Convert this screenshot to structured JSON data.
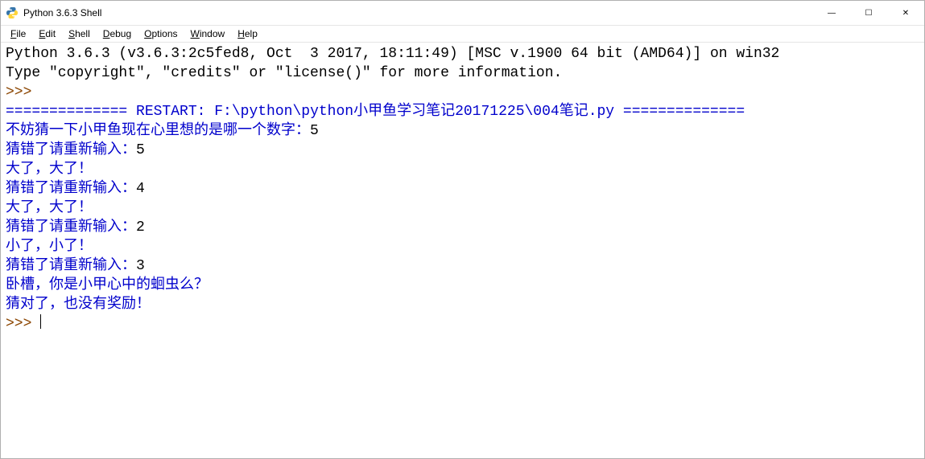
{
  "window": {
    "title": "Python 3.6.3 Shell",
    "controls": {
      "min": "—",
      "max": "☐",
      "close": "✕"
    }
  },
  "menu": {
    "file": {
      "u": "F",
      "rest": "ile"
    },
    "edit": {
      "u": "E",
      "rest": "dit"
    },
    "shell": {
      "u": "S",
      "rest": "hell"
    },
    "debug": {
      "u": "D",
      "rest": "ebug"
    },
    "options": {
      "u": "O",
      "rest": "ptions"
    },
    "window": {
      "u": "W",
      "rest": "indow"
    },
    "help": {
      "u": "H",
      "rest": "elp"
    }
  },
  "console": {
    "banner1": "Python 3.6.3 (v3.6.3:2c5fed8, Oct  3 2017, 18:11:49) [MSC v.1900 64 bit (AMD64)] on win32",
    "banner2": "Type \"copyright\", \"credits\" or \"license()\" for more information.",
    "prompt": ">>> ",
    "restart_pre": "============== RESTART: ",
    "restart_path": "F:\\python\\python小甲鱼学习笔记20171225\\004笔记.py",
    "restart_post": " ==============",
    "prompt1": "不妨猜一下小甲鱼现在心里想的是哪一个数字：",
    "input1": "5",
    "retry1": "猜错了请重新输入：",
    "retry1_in": "5",
    "feedback_big1": "大了，大了！",
    "retry2": "猜错了请重新输入：",
    "retry2_in": "4",
    "feedback_big2": "大了，大了！",
    "retry3": "猜错了请重新输入：",
    "retry3_in": "2",
    "feedback_small": "小了，小了！",
    "retry4": "猜错了请重新输入：",
    "retry4_in": "3",
    "success1": "卧槽，你是小甲心中的蛔虫么？",
    "success2": "猜对了，也没有奖励！"
  }
}
